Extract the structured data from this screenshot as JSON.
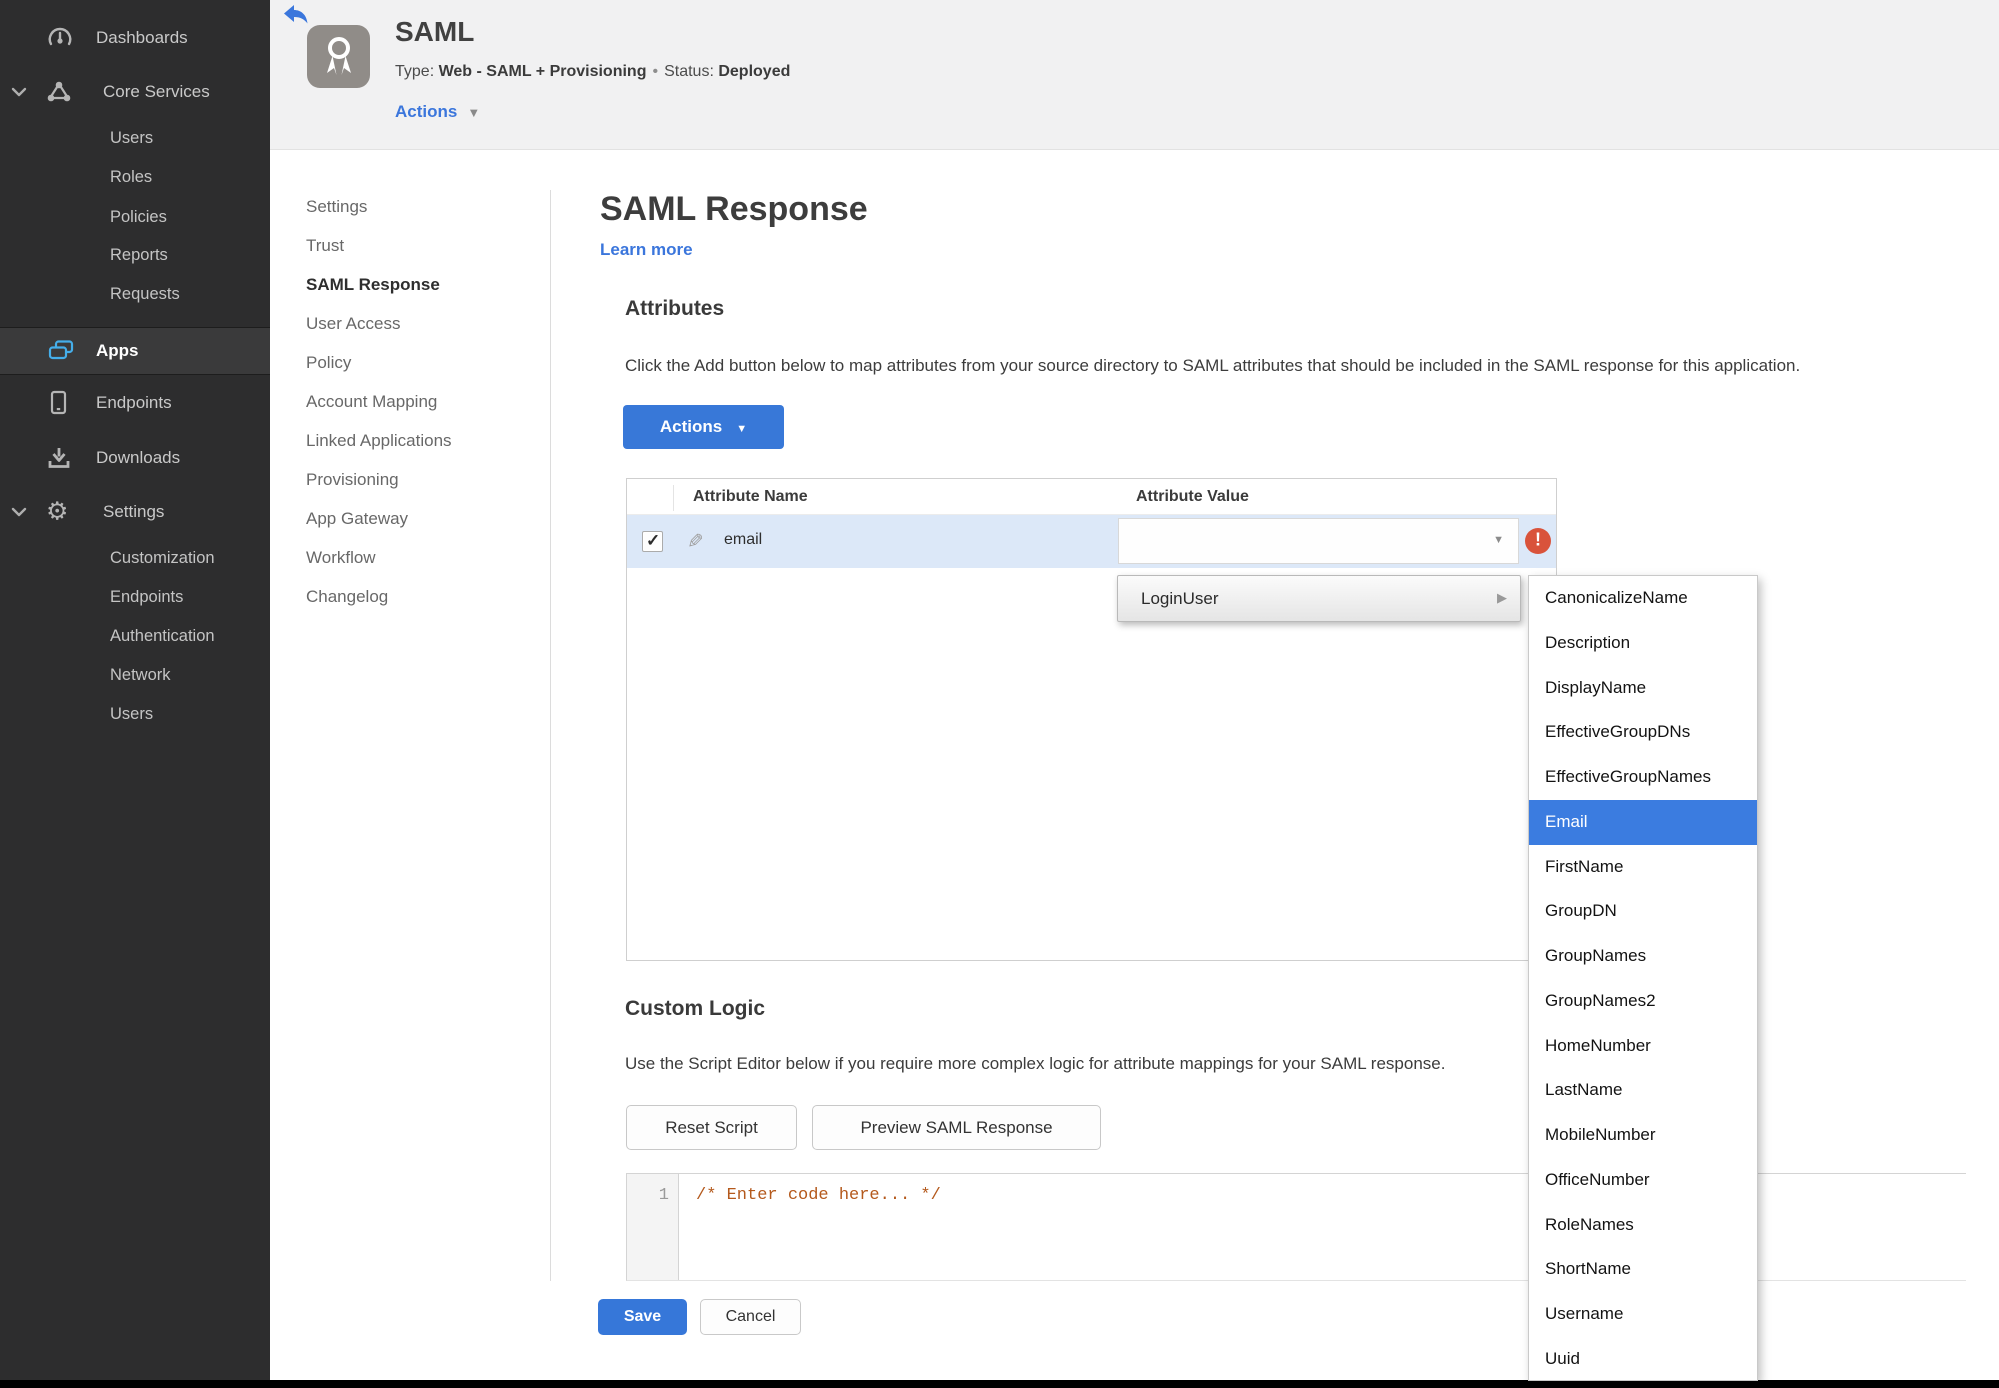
{
  "colors": {
    "accent_blue": "#3b76dc",
    "status_green": "#4b8b22",
    "error_red": "#d9533b",
    "row_selection": "#dce8f8",
    "menu_highlight": "#3b7ce0",
    "code_comment": "#b4591c",
    "apps_icon_blue": "#45aeea",
    "sidebar_bg": "#2d2d2e"
  },
  "sidebar": {
    "items": [
      {
        "label": "Dashboards",
        "icon": "gauge-icon"
      },
      {
        "label": "Core Services",
        "icon": "core-services-icon"
      },
      {
        "label": "Users"
      },
      {
        "label": "Roles"
      },
      {
        "label": "Policies"
      },
      {
        "label": "Reports"
      },
      {
        "label": "Requests"
      },
      {
        "label": "Apps",
        "icon": "apps-icon",
        "active": true
      },
      {
        "label": "Endpoints",
        "icon": "phone-icon"
      },
      {
        "label": "Downloads",
        "icon": "download-icon"
      },
      {
        "label": "Settings",
        "icon": "gear-icon"
      },
      {
        "label": "Customization"
      },
      {
        "label": "Endpoints"
      },
      {
        "label": "Authentication"
      },
      {
        "label": "Network"
      },
      {
        "label": "Users"
      }
    ]
  },
  "header": {
    "back_icon": "back-arrow-icon",
    "app_icon": "award-ribbon-icon",
    "app_title": "SAML",
    "type_label": "Type:",
    "type_value": "Web - SAML + Provisioning",
    "separator": "•",
    "status_label": "Status:",
    "status_value": "Deployed",
    "actions_label": "Actions"
  },
  "subnav": {
    "items": [
      "Settings",
      "Trust",
      "SAML Response",
      "User Access",
      "Policy",
      "Account Mapping",
      "Linked Applications",
      "Provisioning",
      "App Gateway",
      "Workflow",
      "Changelog"
    ],
    "active": "SAML Response"
  },
  "main": {
    "title": "SAML Response",
    "learn_more": "Learn more",
    "attributes": {
      "heading": "Attributes",
      "description": "Click the Add button below to map attributes from your source directory to SAML attributes that should be included in the SAML response for this application.",
      "actions_button": "Actions",
      "table": {
        "columns": [
          "Attribute Name",
          "Attribute Value"
        ],
        "row": {
          "name": "email",
          "checked": true,
          "value": ""
        }
      },
      "value_menu": {
        "selected": "LoginUser",
        "highlighted": "Email",
        "options": [
          "CanonicalizeName",
          "Description",
          "DisplayName",
          "EffectiveGroupDNs",
          "EffectiveGroupNames",
          "Email",
          "FirstName",
          "GroupDN",
          "GroupNames",
          "GroupNames2",
          "HomeNumber",
          "LastName",
          "MobileNumber",
          "OfficeNumber",
          "RoleNames",
          "ShortName",
          "Username",
          "Uuid"
        ]
      }
    },
    "custom_logic": {
      "heading": "Custom Logic",
      "description": "Use the Script Editor below if you require more complex logic for attribute mappings for your SAML response.",
      "reset_button": "Reset Script",
      "preview_button": "Preview SAML Response",
      "editor": {
        "line_number": "1",
        "code": "/* Enter code here... */"
      }
    },
    "footer": {
      "save": "Save",
      "cancel": "Cancel"
    }
  }
}
